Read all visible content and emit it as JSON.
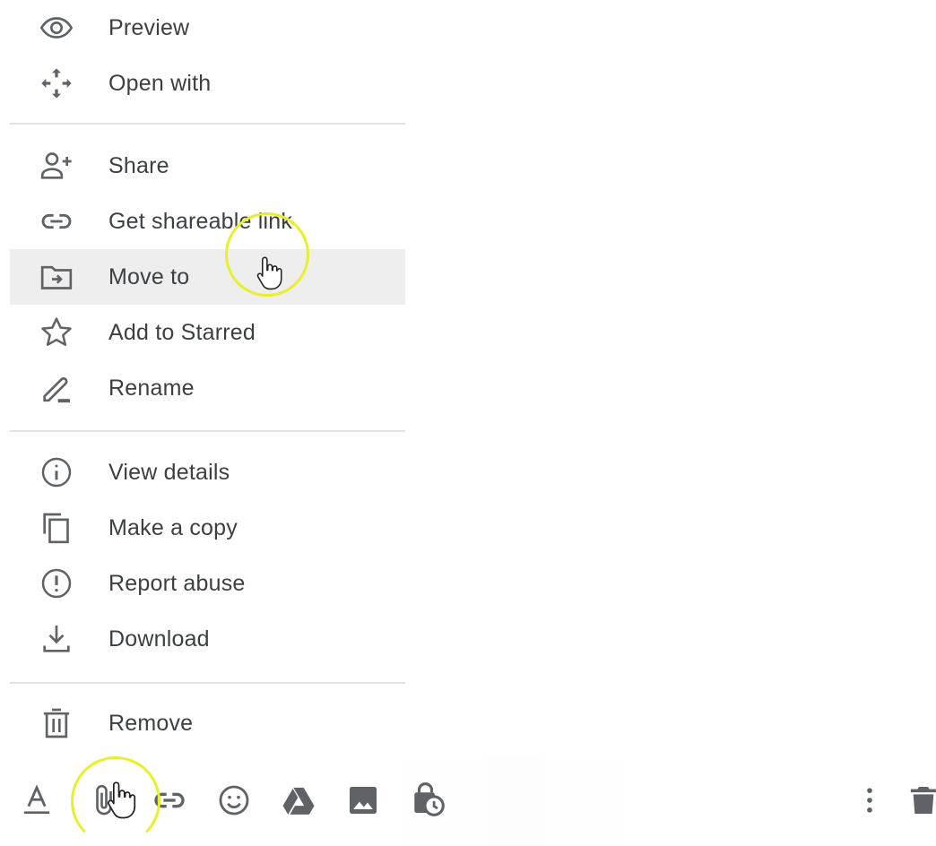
{
  "menu": {
    "items": [
      {
        "label": "Preview",
        "icon": "eye-icon"
      },
      {
        "label": "Open with",
        "icon": "open-with-icon"
      },
      {
        "label": "Share",
        "icon": "person-add-icon"
      },
      {
        "label": "Get shareable link",
        "icon": "link-icon"
      },
      {
        "label": "Move to",
        "icon": "move-folder-icon",
        "state": "hovered"
      },
      {
        "label": "Add to Starred",
        "icon": "star-outline-icon"
      },
      {
        "label": "Rename",
        "icon": "pencil-icon"
      },
      {
        "label": "View details",
        "icon": "info-icon"
      },
      {
        "label": "Make a copy",
        "icon": "copy-icon"
      },
      {
        "label": "Report abuse",
        "icon": "report-icon"
      },
      {
        "label": "Download",
        "icon": "download-icon"
      },
      {
        "label": "Remove",
        "icon": "trash-icon"
      }
    ]
  },
  "toolbar": {
    "buttons": [
      {
        "name": "formatting-options",
        "icon": "text-format-icon"
      },
      {
        "name": "attach-files",
        "icon": "paperclip-icon"
      },
      {
        "name": "insert-link",
        "icon": "link-icon"
      },
      {
        "name": "insert-emoji",
        "icon": "emoji-icon"
      },
      {
        "name": "insert-from-drive",
        "icon": "google-drive-icon"
      },
      {
        "name": "insert-photo",
        "icon": "photo-icon"
      },
      {
        "name": "confidential-mode",
        "icon": "lock-clock-icon"
      },
      {
        "name": "more-options",
        "icon": "more-vert-icon"
      },
      {
        "name": "discard-draft",
        "icon": "trash-icon"
      }
    ]
  },
  "colors": {
    "text": "#3c4043",
    "icon": "#5f6368",
    "hover_row": "#eeeeee",
    "divider": "#e3e3e3",
    "click_highlight": "#e9ef2a"
  }
}
